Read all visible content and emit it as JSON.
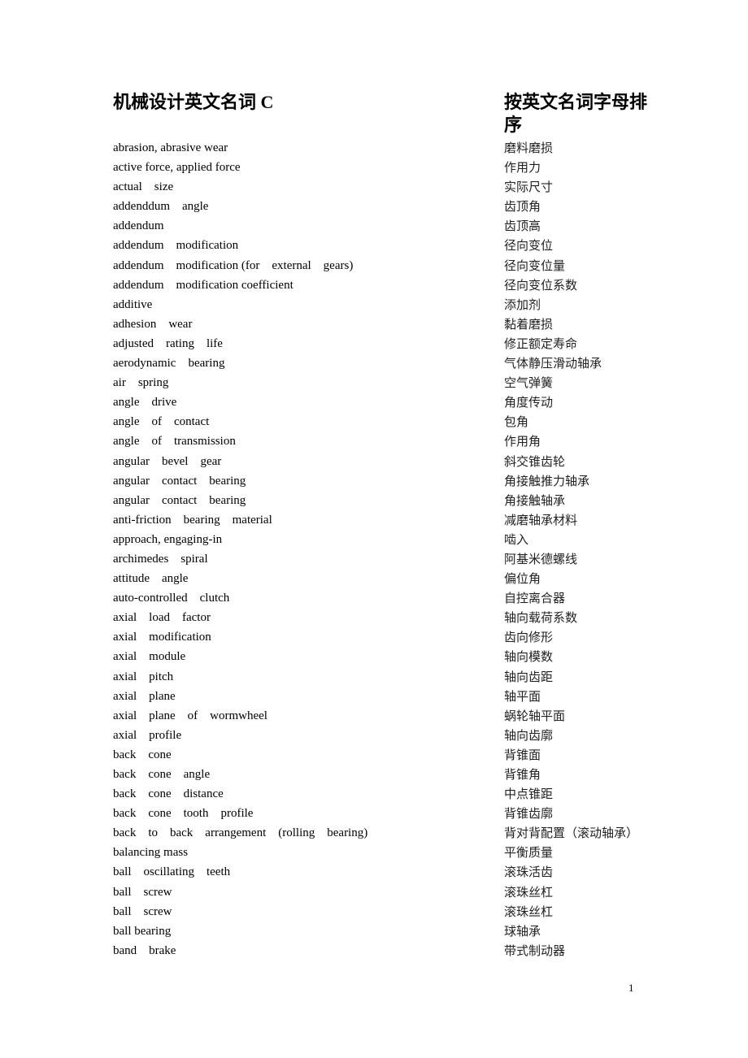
{
  "header": {
    "title": "机械设计英文名词 C",
    "subtitle": "按英文名词字母排序"
  },
  "entries": [
    {
      "en": "abrasion, abrasive wear",
      "zh": "磨料磨损"
    },
    {
      "en": "active force, applied force",
      "zh": "作用力"
    },
    {
      "en": "actual    size",
      "zh": "实际尺寸"
    },
    {
      "en": "addenddum    angle",
      "zh": "齿顶角"
    },
    {
      "en": "addendum",
      "zh": "齿顶高"
    },
    {
      "en": "addendum    modification",
      "zh": "径向变位"
    },
    {
      "en": "addendum    modification (for    external    gears)",
      "zh": "径向变位量"
    },
    {
      "en": "addendum    modification coefficient",
      "zh": "径向变位系数"
    },
    {
      "en": "additive",
      "zh": "添加剂"
    },
    {
      "en": "adhesion    wear",
      "zh": "黏着磨损"
    },
    {
      "en": "adjusted    rating    life",
      "zh": "修正额定寿命"
    },
    {
      "en": "aerodynamic    bearing",
      "zh": "气体静压滑动轴承"
    },
    {
      "en": "air    spring",
      "zh": "空气弹簧"
    },
    {
      "en": "angle    drive",
      "zh": "角度传动"
    },
    {
      "en": "angle    of    contact",
      "zh": "包角"
    },
    {
      "en": "angle    of    transmission",
      "zh": "作用角"
    },
    {
      "en": "angular    bevel    gear",
      "zh": "斜交锥齿轮"
    },
    {
      "en": "angular    contact    bearing",
      "zh": "角接触推力轴承"
    },
    {
      "en": "angular    contact    bearing",
      "zh": "角接触轴承"
    },
    {
      "en": "anti-friction    bearing    material",
      "zh": "减磨轴承材料"
    },
    {
      "en": "approach, engaging-in",
      "zh": "啮入"
    },
    {
      "en": "archimedes    spiral",
      "zh": "阿基米德螺线"
    },
    {
      "en": "attitude    angle",
      "zh": "偏位角"
    },
    {
      "en": "auto-controlled    clutch",
      "zh": "自控离合器"
    },
    {
      "en": "axial    load    factor",
      "zh": "轴向载荷系数"
    },
    {
      "en": "axial    modification",
      "zh": "齿向修形"
    },
    {
      "en": "axial    module",
      "zh": "轴向模数"
    },
    {
      "en": "axial    pitch",
      "zh": "轴向齿距"
    },
    {
      "en": "axial    plane",
      "zh": "轴平面"
    },
    {
      "en": "axial    plane    of    wormwheel",
      "zh": "蜗轮轴平面"
    },
    {
      "en": "axial    profile",
      "zh": "轴向齿廓"
    },
    {
      "en": "back    cone",
      "zh": "背锥面"
    },
    {
      "en": "back    cone    angle",
      "zh": "背锥角"
    },
    {
      "en": "back    cone    distance",
      "zh": "中点锥距"
    },
    {
      "en": "back    cone    tooth    profile",
      "zh": "背锥齿廓"
    },
    {
      "en": "back    to    back    arrangement    (rolling    bearing)",
      "zh": "背对背配置（滚动轴承）"
    },
    {
      "en": "balancing mass",
      "zh": "平衡质量"
    },
    {
      "en": "ball    oscillating    teeth",
      "zh": "滚珠活齿"
    },
    {
      "en": "ball    screw",
      "zh": "滚珠丝杠"
    },
    {
      "en": "ball    screw",
      "zh": "滚珠丝杠"
    },
    {
      "en": "ball bearing",
      "zh": "球轴承"
    },
    {
      "en": "band    brake",
      "zh": "带式制动器"
    }
  ],
  "footer": {
    "page_number": "1"
  }
}
